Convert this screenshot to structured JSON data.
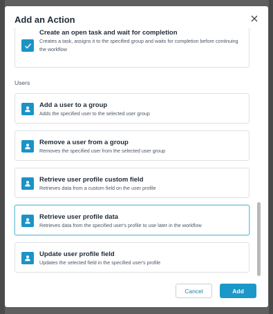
{
  "dialog": {
    "title": "Add an Action",
    "close_icon": "close-icon"
  },
  "top_card": {
    "title": "Create an open task and wait for completion",
    "description": "Creates a task, assigns it to the specified group and waits for completion before continuing the workflow",
    "icon": "checkmark-icon"
  },
  "users_section": {
    "label": "Users",
    "items": [
      {
        "title": "Add a user to a group",
        "description": "Adds the specified user to the selected user group",
        "icon": "user-icon"
      },
      {
        "title": "Remove a user from a group",
        "description": "Removes the specified user from the selected user group",
        "icon": "user-icon"
      },
      {
        "title": "Retrieve user profile custom field",
        "description": "Retrieves data from a custom field on the user profile",
        "icon": "user-icon"
      },
      {
        "title": "Retrieve user profile data",
        "description": "Retrieves data from the specified user's profile to use later in the workflow",
        "icon": "user-icon",
        "selected": true
      },
      {
        "title": "Update user profile field",
        "description": "Updates the selected field in the specified user's profile",
        "icon": "user-icon"
      }
    ]
  },
  "footer": {
    "cancel_label": "Cancel",
    "add_label": "Add"
  },
  "colors": {
    "accent": "#1b98c8",
    "icon_bg": "#1b93c6",
    "selected_border": "#7cc6de",
    "backdrop": "#5f5f5f"
  }
}
